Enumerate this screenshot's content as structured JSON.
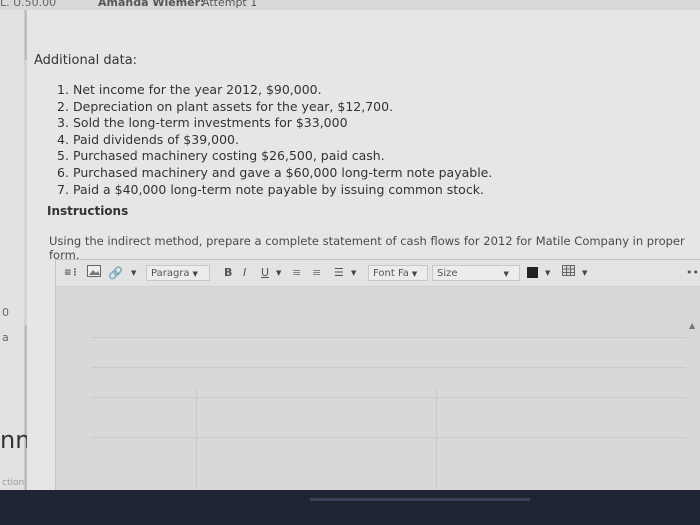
{
  "header": {
    "left_text": "L. U.50.00",
    "user": "Amanda Wiemer:",
    "attempt": "Attempt 1"
  },
  "side": {
    "mark_one": "0",
    "mark_two": "a",
    "word": "nne",
    "caption": "ction to t"
  },
  "additional": {
    "heading": "Additional data:",
    "items": [
      {
        "num": "1.",
        "text": "Net income for the year 2012, $90,000."
      },
      {
        "num": "2.",
        "text": "Depreciation on plant assets for the year, $12,700."
      },
      {
        "num": "3.",
        "text": "Sold the long-term investments for $33,000"
      },
      {
        "num": "4.",
        "text": "Paid dividends of $39,000."
      },
      {
        "num": "5.",
        "text": "Purchased machinery costing $26,500, paid cash."
      },
      {
        "num": "6.",
        "text": "Purchased machinery and gave a $60,000 long-term note payable."
      },
      {
        "num": "7.",
        "text": "Paid a $40,000 long-term note payable by issuing common stock."
      }
    ]
  },
  "instructions": {
    "title": "Instructions",
    "text": "Using the indirect method, prepare a complete statement of cash flows for 2012 for Matile Company in proper form."
  },
  "editor": {
    "paragraph_label": "Paragra",
    "bold_label": "B",
    "italic_label": "I",
    "underline_label": "U",
    "font_label": "Font Fa",
    "size_label": "Size",
    "more_label": "•••",
    "text_color": "#222222",
    "icons": [
      "code-icon",
      "image-icon",
      "link-icon",
      "ordered-list-icon",
      "unordered-list-icon",
      "table-icon"
    ]
  }
}
